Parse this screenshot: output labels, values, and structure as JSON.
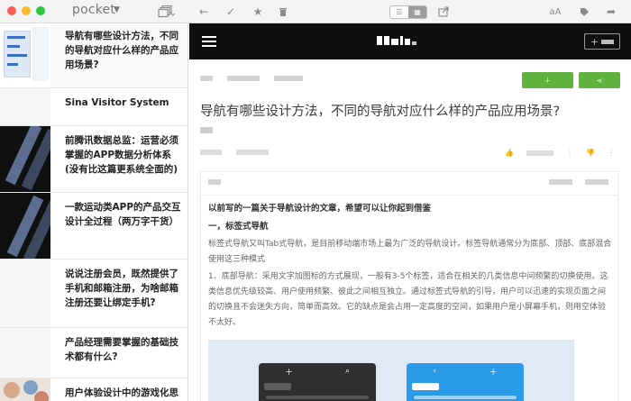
{
  "app": {
    "brand": "pocket",
    "view_toggle": {
      "options": [
        "list",
        "tile"
      ],
      "selected": "tile"
    }
  },
  "sidebar": {
    "items": [
      {
        "title": "导航有哪些设计方法，不同的导航对应什么样的产品应用场景?",
        "meta": "",
        "thumb": "blue"
      },
      {
        "title": "Sina Visitor System",
        "meta": "",
        "thumb": "plain"
      },
      {
        "title": "前腾讯数据总监：运营必须掌握的APP数据分析体系(没有比这篇更系统全面的)",
        "meta": "",
        "thumb": "dark"
      },
      {
        "title": "一款运动类APP的产品交互设计全过程（两万字干货）",
        "meta": "",
        "thumb": "dark"
      },
      {
        "title": "说说注册会员，既然提供了手机和邮箱注册，为啥邮箱注册还要让绑定手机?",
        "meta": "",
        "thumb": "plain"
      },
      {
        "title": "产品经理需要掌握的基础技术都有什么?",
        "meta": "",
        "thumb": "plain"
      },
      {
        "title": "用户体验设计中的游戏化思维",
        "meta": "",
        "thumb": "photo"
      }
    ]
  },
  "article": {
    "title": "导航有哪些设计方法，不同的导航对应什么样的产品应用场景?",
    "lead": "以前写的一篇关于导航设计的文章，希望可以让你起到借鉴",
    "heading1": "一，标签式导航",
    "para1": "标签式导航又叫Tab式导航，是目前移动端市场上最为广泛的导航设计。标签导航通常分为底部、顶部、底部混合使用这三种模式",
    "para2": "1、底部导航：采用文字加图标的方式展现，一般有3-5个标签，适合在相关的几类信息中间频繁的切换使用。这类信息优先级较高、用户使用频繁、彼此之间相互独立。通过标签式导航的引导，用户可以迅速的实现页面之间的切换且不会迷失方向，简单而高效。它的缺点是会占用一定高度的空间，如果用户是小屏幕手机，则用空体验不太好。"
  }
}
